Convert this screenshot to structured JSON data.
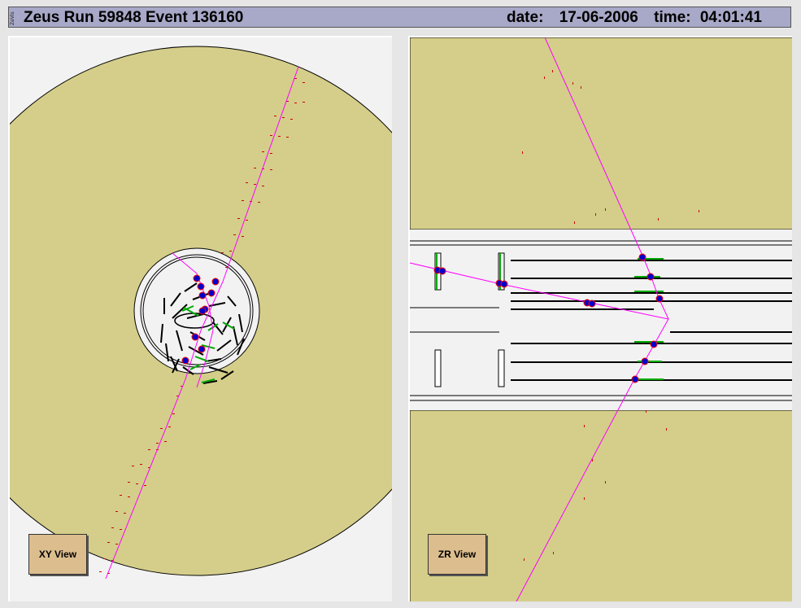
{
  "header": {
    "logo_text": "ZeVis",
    "title": "Zeus Run 59848 Event 136160",
    "date_label": "date:",
    "date_value": "17-06-2006",
    "time_label": "time:",
    "time_value": "04:01:41"
  },
  "views": {
    "xy": {
      "button_label": "XY View"
    },
    "zr": {
      "button_label": "ZR View"
    }
  },
  "colors": {
    "calorimeter": "#d4ce8a",
    "background": "#f2f2f2",
    "track": "#ff00ff",
    "hit": "#0000cc",
    "segment": "#00aa00",
    "energy": "#cc0000",
    "header": "#a8a8c8",
    "button": "#dcbd8e"
  }
}
